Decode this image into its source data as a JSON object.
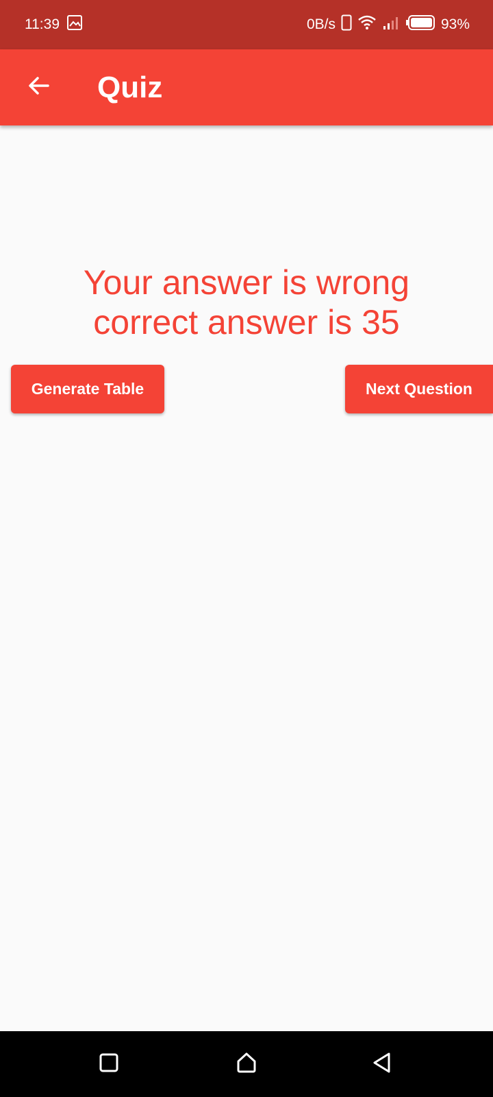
{
  "status_bar": {
    "time": "11:39",
    "network_speed": "0B/s",
    "battery": "93%",
    "icons": [
      "gallery-icon",
      "phone-icon",
      "wifi-icon",
      "signal-icon",
      "battery-icon"
    ]
  },
  "app_bar": {
    "title": "Quiz",
    "back_icon": "arrow-back-icon",
    "color": "#f44336"
  },
  "result": {
    "line1": "Your answer is wrong",
    "line2": "correct answer is  35",
    "color": "#f44336"
  },
  "buttons": {
    "generate_table": "Generate Table",
    "next_question": "Next Question"
  },
  "nav_bar": {
    "icons": [
      "recents-icon",
      "home-icon",
      "back-icon"
    ]
  },
  "colors": {
    "status_bar": "#b53128",
    "accent": "#f44336",
    "background": "#fafafa"
  }
}
